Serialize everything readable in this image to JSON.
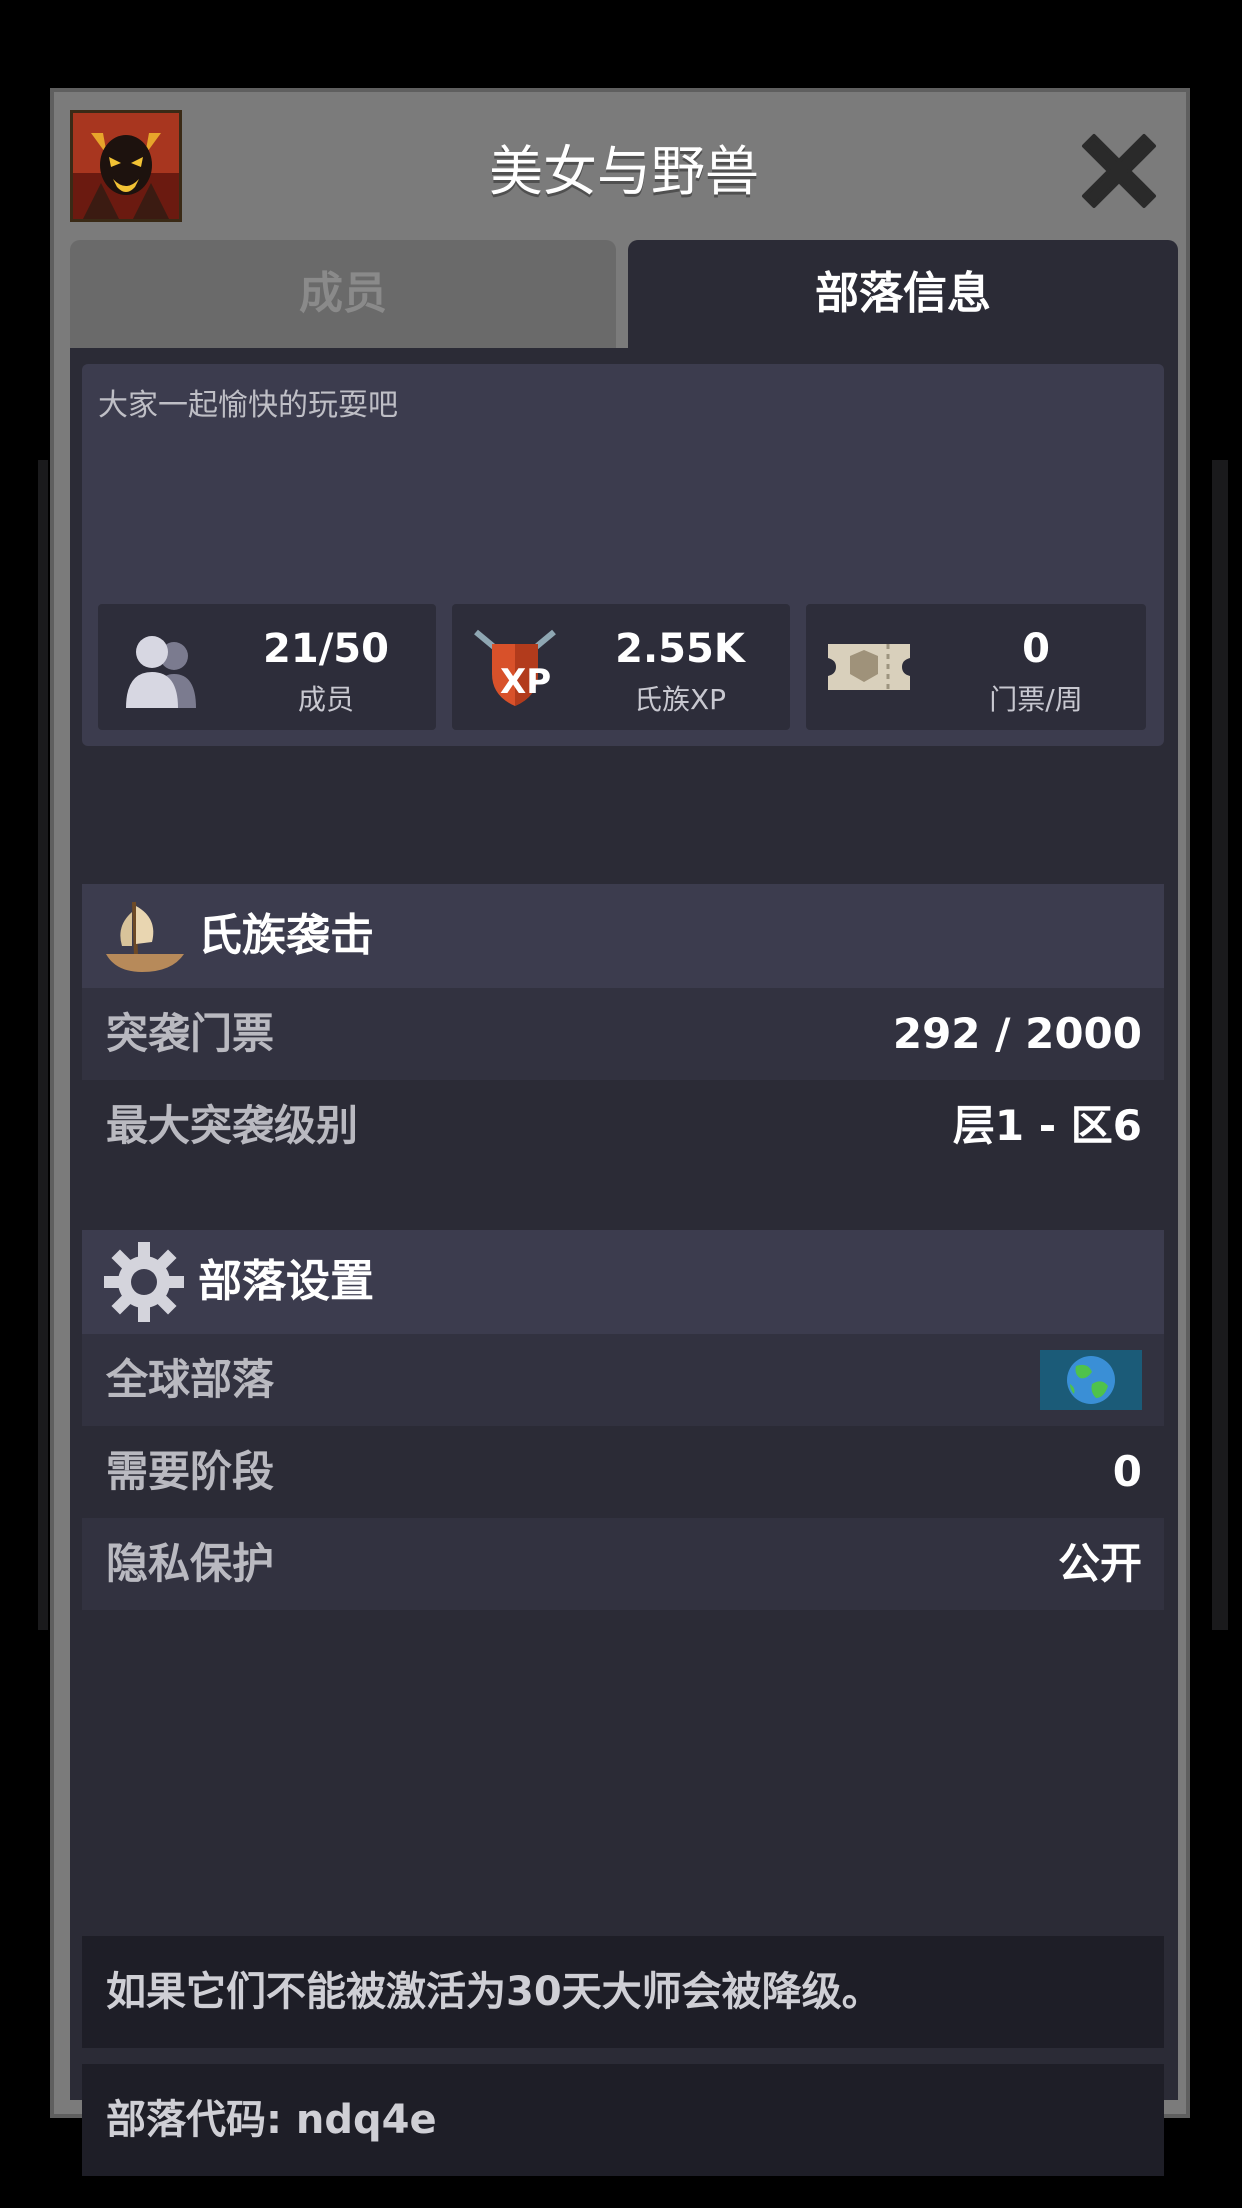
{
  "header": {
    "title": "美女与野兽",
    "avatar_icon": "demon-avatar-icon",
    "close_icon": "close-icon"
  },
  "tabs": [
    {
      "label": "成员",
      "active": false
    },
    {
      "label": "部落信息",
      "active": true
    }
  ],
  "description": "大家一起愉快的玩耍吧",
  "stats": [
    {
      "value": "21/50",
      "label": "成员",
      "icon": "members-icon"
    },
    {
      "value": "2.55K",
      "label": "氏族XP",
      "icon": "xp-shield-icon"
    },
    {
      "value": "0",
      "label": "门票/周",
      "icon": "ticket-icon"
    }
  ],
  "raid": {
    "title": "氏族袭击",
    "icon": "ship-icon",
    "rows": [
      {
        "label": "突袭门票",
        "value": "292 / 2000"
      },
      {
        "label": "最大突袭级别",
        "value": "层1 - 区6"
      }
    ]
  },
  "settings": {
    "title": "部落设置",
    "icon": "gear-icon",
    "rows": [
      {
        "label": "全球部落",
        "value": "",
        "icon": "globe-icon"
      },
      {
        "label": "需要阶段",
        "value": "0"
      },
      {
        "label": "隐私保护",
        "value": "公开"
      }
    ]
  },
  "footer": {
    "demotion_note": "如果它们不能被激活为30天大师会被降级。",
    "clan_code": "部落代码: ndq4e"
  },
  "colors": {
    "panel": "#7b7b7b",
    "content_bg": "#2b2b36",
    "section_bg": "#3c3c4e",
    "text": "#ffffff"
  }
}
